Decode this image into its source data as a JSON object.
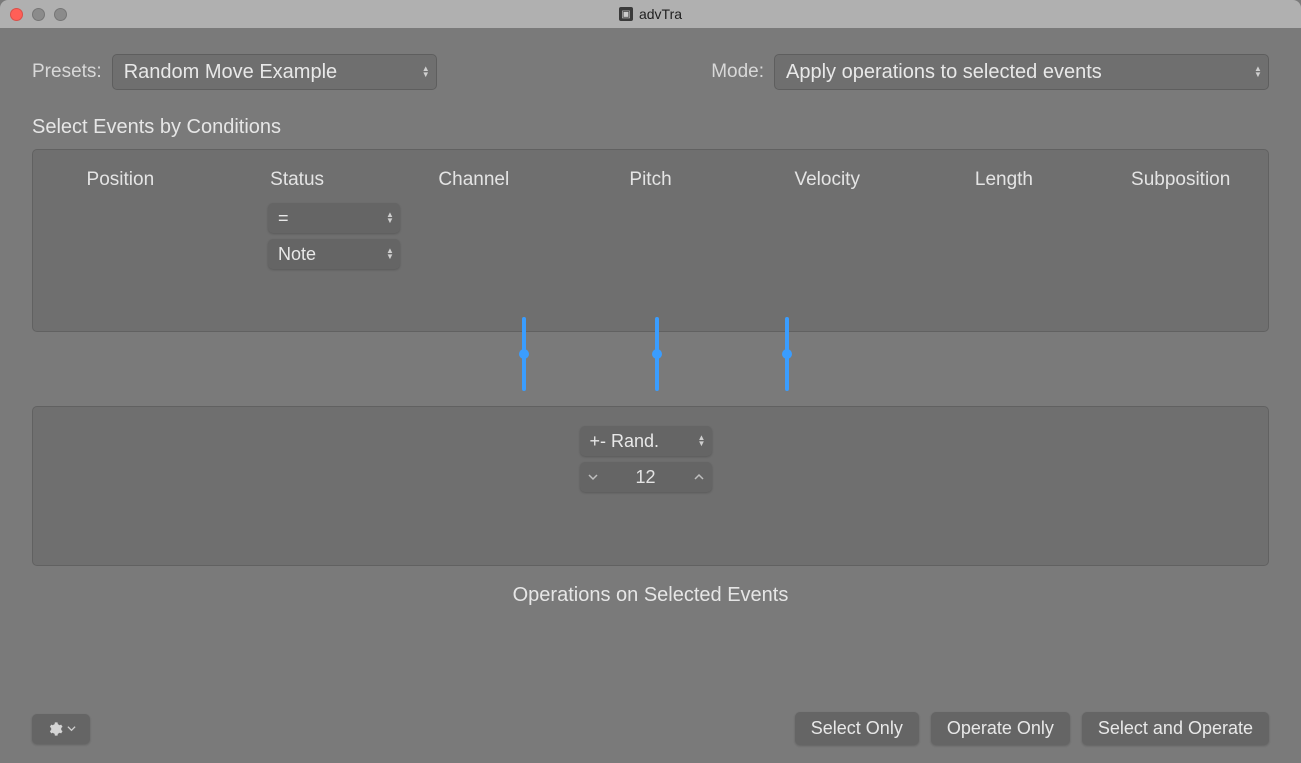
{
  "window": {
    "title": "advTra"
  },
  "top": {
    "presets_label": "Presets:",
    "preset_value": "Random Move Example",
    "mode_label": "Mode:",
    "mode_value": "Apply operations to selected events"
  },
  "conditions": {
    "section_label": "Select Events by Conditions",
    "headers": {
      "position": "Position",
      "status": "Status",
      "channel": "Channel",
      "pitch": "Pitch",
      "velocity": "Velocity",
      "length": "Length",
      "subposition": "Subposition"
    },
    "status_operator": "=",
    "status_type": "Note"
  },
  "operations": {
    "mode": "+- Rand.",
    "value": "12",
    "section_label": "Operations on Selected Events"
  },
  "buttons": {
    "select_only": "Select Only",
    "operate_only": "Operate Only",
    "select_and_operate": "Select and Operate"
  }
}
